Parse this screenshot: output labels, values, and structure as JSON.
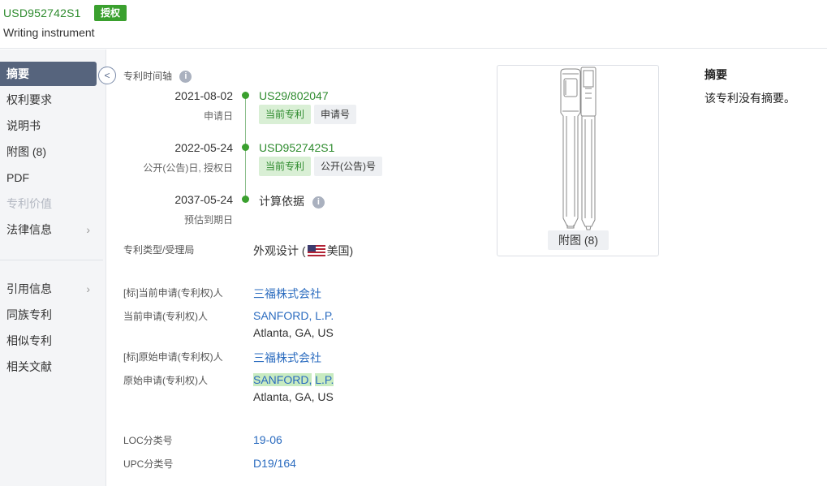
{
  "header": {
    "patent_number": "USD952742S1",
    "status_badge": "授权",
    "title": "Writing instrument"
  },
  "sidebar": {
    "items": [
      {
        "label": "摘要",
        "active": true
      },
      {
        "label": "权利要求"
      },
      {
        "label": "说明书"
      },
      {
        "label": "附图 (8)"
      },
      {
        "label": "PDF"
      },
      {
        "label": "专利价值",
        "disabled": true
      },
      {
        "label": "法律信息",
        "chevron": ">"
      },
      {
        "label": "引用信息",
        "chevron": ">"
      },
      {
        "label": "同族专利"
      },
      {
        "label": "相似专利"
      },
      {
        "label": "相关文献"
      }
    ]
  },
  "timeline": {
    "title": "专利时间轴",
    "info_icon": "i",
    "events": [
      {
        "date": "2021-08-02",
        "sub": "申请日",
        "id": "US29/802047",
        "tags": [
          "当前专利",
          "申请号"
        ]
      },
      {
        "date": "2022-05-24",
        "sub": "公开(公告)日, 授权日",
        "id": "USD952742S1",
        "tags": [
          "当前专利",
          "公开(公告)号"
        ]
      },
      {
        "date": "2037-05-24",
        "sub": "预估到期日",
        "id": "计算依据"
      }
    ]
  },
  "details": {
    "type_label": "专利类型/受理局",
    "type_value": "外观设计 (",
    "country": "美国)",
    "std_current_assignee_label": "[标]当前申请(专利权)人",
    "std_current_assignee": "三福株式会社",
    "current_assignee_label": "当前申请(专利权)人",
    "current_assignee": "SANFORD, L.P.",
    "current_assignee_addr": "Atlanta, GA, US",
    "std_original_assignee_label": "[标]原始申请(专利权)人",
    "std_original_assignee": "三福株式会社",
    "original_assignee_label": "原始申请(专利权)人",
    "original_assignee_part1": "SANFORD,",
    "original_assignee_part2": "L.P.",
    "original_assignee_addr": "Atlanta, GA, US",
    "loc_label": "LOC分类号",
    "loc_value": "19-06",
    "upc_label": "UPC分类号",
    "upc_value": "D19/164"
  },
  "figure": {
    "label": "附图 (8)"
  },
  "abstract": {
    "title": "摘要",
    "text": "该专利没有摘要。"
  },
  "colors": {
    "accent_green": "#3aa02e",
    "link_blue": "#2a6bbf",
    "active_nav": "#56647d"
  }
}
